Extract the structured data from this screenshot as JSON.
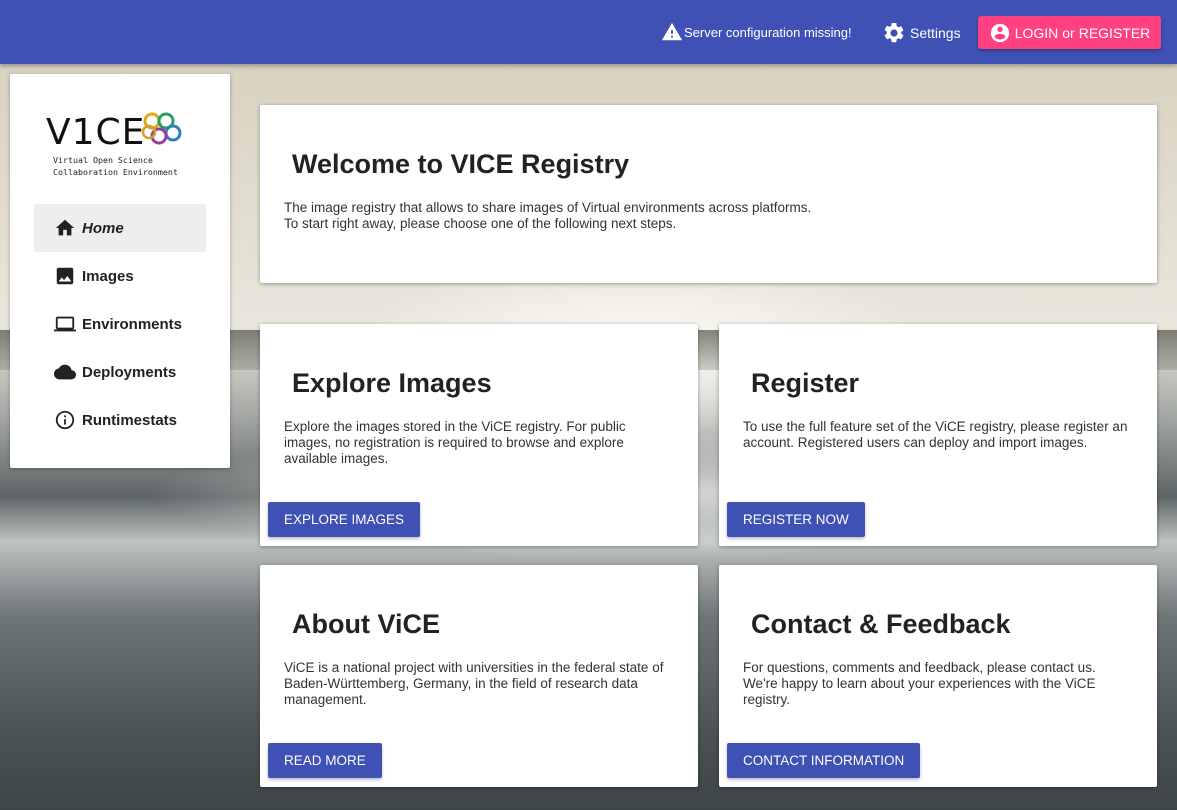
{
  "topbar": {
    "warning_text": "Server configuration missing!",
    "settings_label": "Settings",
    "login_label": "LOGIN",
    "login_or": "or",
    "register_label": "REGISTER",
    "bar_color": "#3f51b5",
    "accent_color": "#ff4081"
  },
  "sidebar": {
    "logo_title": "ViCE",
    "logo_subtitle_1": "Virtual Open Science",
    "logo_subtitle_2": "Collaboration Environment",
    "items": [
      {
        "label": "Home",
        "icon": "home-icon",
        "active": true
      },
      {
        "label": "Images",
        "icon": "image-icon",
        "active": false
      },
      {
        "label": "Environments",
        "icon": "laptop-icon",
        "active": false
      },
      {
        "label": "Deployments",
        "icon": "cloud-icon",
        "active": false
      },
      {
        "label": "Runtimestats",
        "icon": "info-icon",
        "active": false
      }
    ]
  },
  "welcome": {
    "title": "Welcome to VICE Registry",
    "line1": "The image registry that allows to share images of Virtual environments across platforms.",
    "line2": "To start right away, please choose one of the following next steps."
  },
  "explore": {
    "title": "Explore Images",
    "text": "Explore the images stored in the ViCE registry. For public images, no registration is required to browse and explore available images.",
    "button": "EXPLORE IMAGES"
  },
  "register": {
    "title": "Register",
    "text": "To use the full feature set of the ViCE registry, please register an account. Registered users can deploy and import images.",
    "button": "REGISTER NOW"
  },
  "about": {
    "title": "About ViCE",
    "text": "ViCE is a national project with universities in the federal state of Baden-Württemberg, Germany, in the field of research data management.",
    "button": "READ MORE"
  },
  "contact": {
    "title": "Contact & Feedback",
    "text": "For questions, comments and feedback, please contact us. We're happy to learn about your experiences with the ViCE registry.",
    "button": "CONTACT INFORMATION"
  }
}
